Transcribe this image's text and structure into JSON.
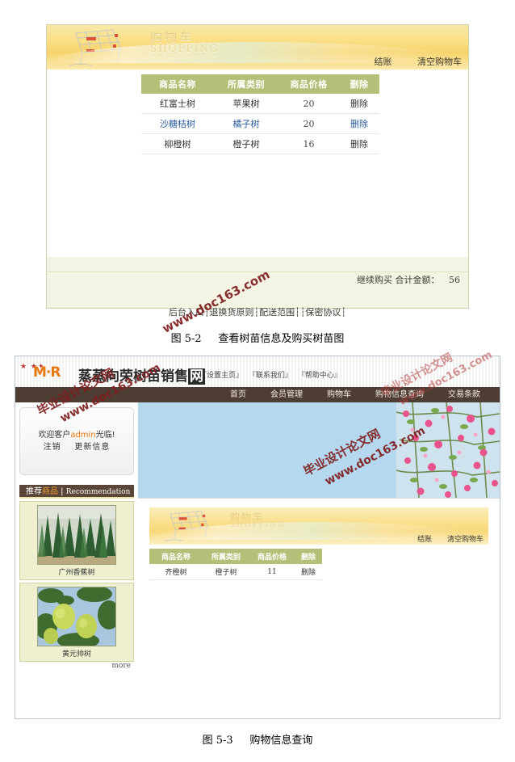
{
  "figure1": {
    "caption_label": "图",
    "caption_num": "5-2",
    "caption_text": "查看树苗信息及购买树苗图",
    "cart_banner": {
      "title_cn": "购物车",
      "title_en": "SHOPPING",
      "checkout": "结账",
      "clear_cart": "清空购物车"
    },
    "table": {
      "headers": [
        "商品名称",
        "所属类别",
        "商品价格",
        "删除"
      ],
      "rows": [
        {
          "name": "红富士树",
          "category": "苹果树",
          "price": "20",
          "action": "删除",
          "highlight": false
        },
        {
          "name": "沙糖桔树",
          "category": "橘子树",
          "price": "20",
          "action": "删除",
          "highlight": true
        },
        {
          "name": "柳橙树",
          "category": "橙子树",
          "price": "16",
          "action": "删除",
          "highlight": false
        }
      ]
    },
    "footer_bar": {
      "continue": "继续购买",
      "total_label": "合计金额：",
      "total_value": "56"
    },
    "site_footer": "后台入口┆退换货原则┆配送范围┆┆保密协议┆"
  },
  "figure2": {
    "caption_label": "图",
    "caption_num": "5-3",
    "caption_text": "购物信息查询",
    "header": {
      "logo_text": "M·R",
      "site_name_a": "蒸蒸向荣树苗销售",
      "site_name_box": "网",
      "links": [
        "『设置主页』",
        "『联系我们』",
        "『帮助中心』"
      ]
    },
    "nav": [
      "首页",
      "会员管理",
      "购物车",
      "购物信息查询",
      "交易条款"
    ],
    "sidebar": {
      "welcome_prefix": "欢迎客户",
      "welcome_user": "admin",
      "welcome_suffix": "光临!",
      "logout": "注销",
      "update": "更新信息",
      "rec_cn1": "推荐",
      "rec_cn2": "商品",
      "rec_sep": " | ",
      "rec_en": "Recommendation",
      "products": [
        {
          "label": "广州香蕉树",
          "image": "fir-trees-photo"
        },
        {
          "label": "黄元帅树",
          "image": "green-apples-photo"
        }
      ],
      "more": "more"
    },
    "hero_image": "pink-blossom-photo",
    "cart_banner": {
      "title_cn": "购物车",
      "title_en": "SHOPPING",
      "checkout": "结账",
      "clear_cart": "清空购物车"
    },
    "table": {
      "headers": [
        "商品名称",
        "所属类别",
        "商品价格",
        "删除"
      ],
      "rows": [
        {
          "name": "齐橙树",
          "category": "橙子树",
          "price": "11",
          "action": "删除"
        }
      ]
    }
  },
  "watermarks": {
    "line1": "毕业设计论文网",
    "line2": "www.doc163.com"
  },
  "colors": {
    "header_green": "#b4bf77",
    "cart_yellow": "#fadf86",
    "nav_brown": "#4e3d33",
    "accent_orange": "#e8770d",
    "hero_blue": "#b5d8ee"
  }
}
